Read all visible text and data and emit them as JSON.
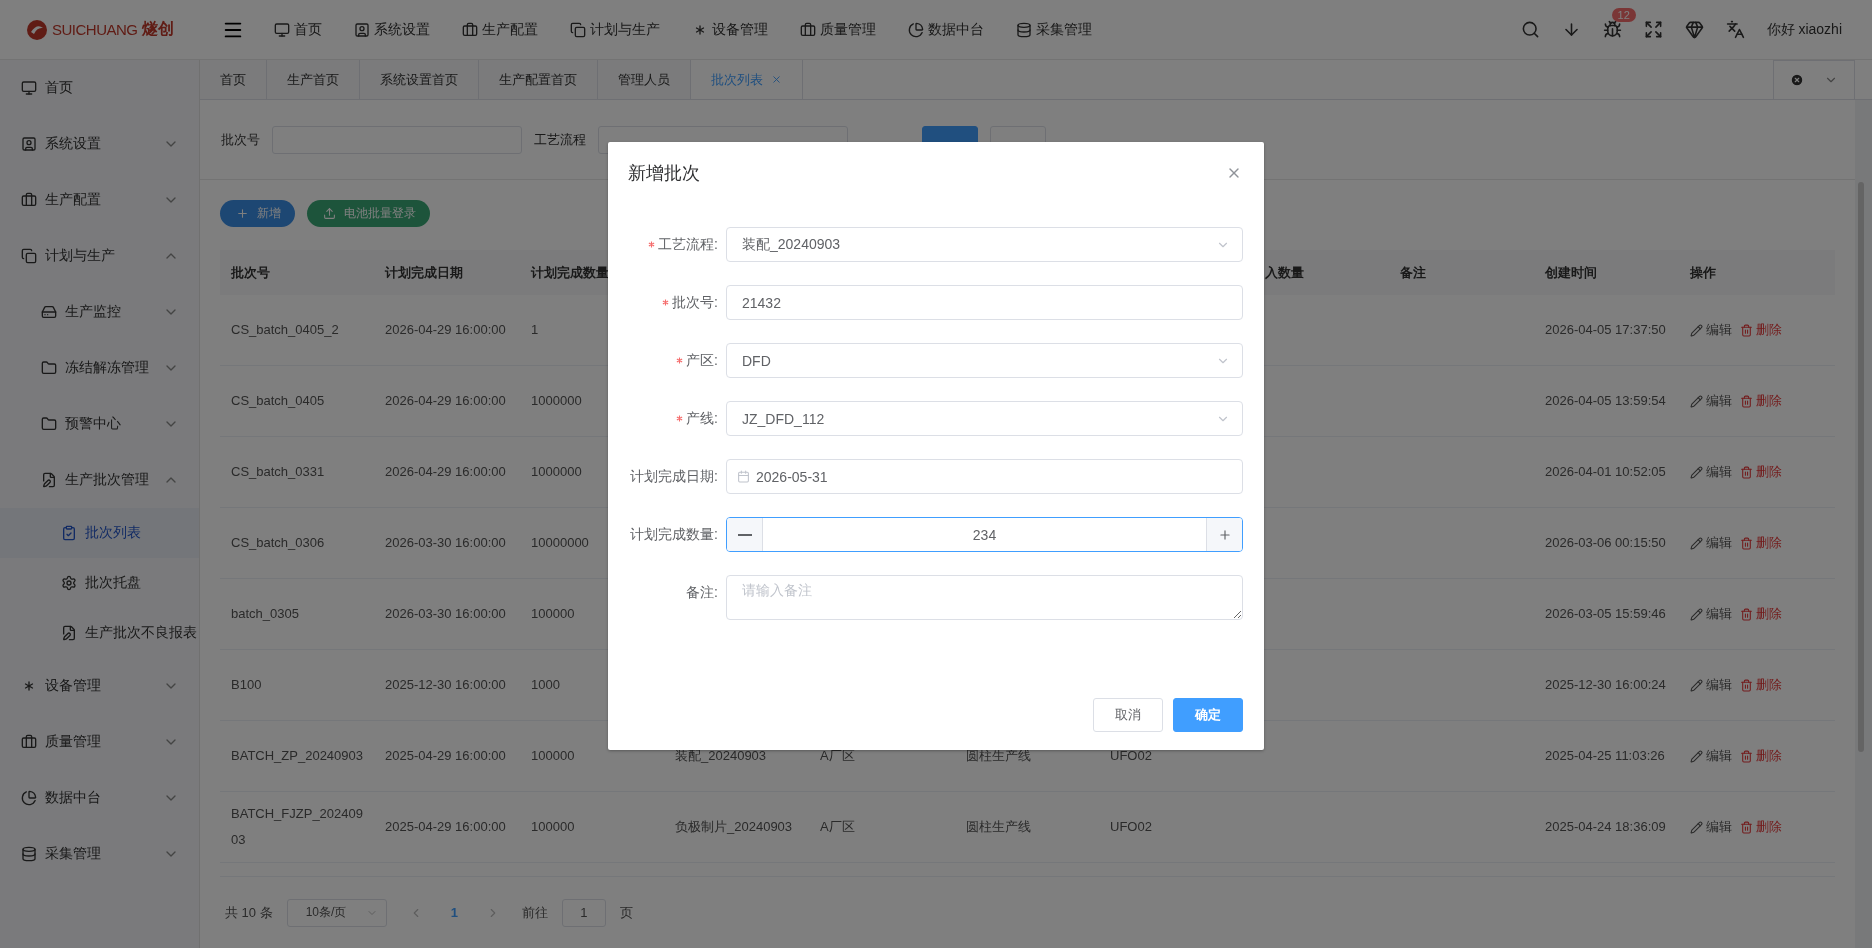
{
  "header": {
    "logo": {
      "latin": "SUICHUANG",
      "chinese": "燧创"
    },
    "nav": [
      {
        "label": "首页"
      },
      {
        "label": "系统设置"
      },
      {
        "label": "生产配置"
      },
      {
        "label": "计划与生产"
      },
      {
        "label": "设备管理"
      },
      {
        "label": "质量管理"
      },
      {
        "label": "数据中台"
      },
      {
        "label": "采集管理"
      }
    ],
    "notification_badge": "12",
    "greeting": "你好 xiaozhi"
  },
  "sidebar": {
    "items": [
      {
        "label": "首页",
        "selected": false
      },
      {
        "label": "系统设置",
        "selected": false,
        "expanded": false
      },
      {
        "label": "生产配置",
        "selected": false,
        "expanded": false
      },
      {
        "label": "计划与生产",
        "selected": false,
        "expanded": true,
        "children": [
          {
            "label": "生产监控",
            "selected": false,
            "expanded": false
          },
          {
            "label": "冻结解冻管理",
            "selected": false,
            "expanded": false
          },
          {
            "label": "预警中心",
            "selected": false,
            "expanded": false
          },
          {
            "label": "生产批次管理",
            "selected": false,
            "expanded": true,
            "children": [
              {
                "label": "批次列表",
                "selected": true
              },
              {
                "label": "批次托盘",
                "selected": false
              },
              {
                "label": "生产批次不良报表",
                "selected": false
              }
            ]
          }
        ]
      },
      {
        "label": "设备管理",
        "selected": false,
        "expanded": false
      },
      {
        "label": "质量管理",
        "selected": false,
        "expanded": false
      },
      {
        "label": "数据中台",
        "selected": false,
        "expanded": false
      },
      {
        "label": "采集管理",
        "selected": false,
        "expanded": false
      }
    ]
  },
  "tabs": [
    {
      "label": "首页",
      "selected": false
    },
    {
      "label": "生产首页",
      "selected": false
    },
    {
      "label": "系统设置首页",
      "selected": false
    },
    {
      "label": "生产配置首页",
      "selected": false
    },
    {
      "label": "管理人员",
      "selected": false
    },
    {
      "label": "批次列表",
      "selected": true,
      "closable": true
    }
  ],
  "filters": {
    "batch_label": "批次号",
    "process_label": "工艺流程"
  },
  "toolbar": {
    "add_button": "新增",
    "import_button": "电池批量登录"
  },
  "table": {
    "columns": [
      "批次号",
      "计划完成日期",
      "计划完成数量",
      "入数量",
      "备注",
      "创建时间",
      "操作"
    ],
    "rows": [
      {
        "batch_no": "CS_batch_0405_2",
        "planned_date": "2026-04-29 16:00:00",
        "planned_qty": "1",
        "created_at": "2026-04-05 17:37:50",
        "actions": [
          "编辑",
          "删除"
        ]
      },
      {
        "batch_no": "CS_batch_0405",
        "planned_date": "2026-04-29 16:00:00",
        "planned_qty": "1000000",
        "created_at": "2026-04-05 13:59:54",
        "actions": [
          "编辑",
          "删除"
        ]
      },
      {
        "batch_no": "CS_batch_0331",
        "planned_date": "2026-04-29 16:00:00",
        "planned_qty": "1000000",
        "created_at": "2026-04-01 10:52:05",
        "actions": [
          "编辑",
          "删除"
        ]
      },
      {
        "batch_no": "CS_batch_0306",
        "planned_date": "2026-03-30 16:00:00",
        "planned_qty": "10000000",
        "created_at": "2026-03-06 00:15:50",
        "actions": [
          "编辑",
          "删除"
        ]
      },
      {
        "batch_no": "batch_0305",
        "planned_date": "2026-03-30 16:00:00",
        "planned_qty": "100000",
        "created_at": "2026-03-05 15:59:46",
        "actions": [
          "编辑",
          "删除"
        ]
      },
      {
        "batch_no": "B100",
        "planned_date": "2025-12-30 16:00:00",
        "planned_qty": "1000",
        "created_at": "2025-12-30 16:00:24",
        "actions": [
          "编辑",
          "删除"
        ]
      },
      {
        "batch_no": "BATCH_ZP_20240903",
        "planned_date": "2025-04-29 16:00:00",
        "planned_qty": "100000",
        "column_4": "装配_20240903",
        "column_5": "A厂区",
        "column_6": "圆柱生产线",
        "column_7": "UFO02",
        "created_at": "2025-04-25 11:03:26",
        "actions": [
          "编辑",
          "删除"
        ]
      },
      {
        "batch_no": "BATCH_FJZP_20240903",
        "planned_date": "2025-04-29 16:00:00",
        "planned_qty": "100000",
        "column_4": "负极制片_20240903",
        "column_5": "A厂区",
        "column_6": "圆柱生产线",
        "column_7": "UFO02",
        "created_at": "2025-04-24 18:36:09",
        "actions": [
          "编辑",
          "删除"
        ]
      }
    ]
  },
  "pagination": {
    "total": "共 10 条",
    "page_size": "10条/页",
    "pages": [
      {
        "label": "1",
        "selected": true
      }
    ],
    "goto_label": "前往",
    "goto_value": "1",
    "page_suffix": "页"
  },
  "modal": {
    "title": "新增批次",
    "fields": [
      {
        "kind": "select",
        "label": "工艺流程:",
        "required": true,
        "value": "装配_20240903"
      },
      {
        "kind": "text",
        "label": "批次号:",
        "required": true,
        "value": "21432"
      },
      {
        "kind": "select",
        "label": "产区:",
        "required": true,
        "value": "DFD"
      },
      {
        "kind": "select",
        "label": "产线:",
        "required": true,
        "value": "JZ_DFD_112"
      },
      {
        "kind": "date",
        "label": "计划完成日期:",
        "required": false,
        "value": "2026-05-31"
      },
      {
        "kind": "number",
        "label": "计划完成数量:",
        "required": false,
        "value": "234",
        "focused": true
      },
      {
        "kind": "textarea",
        "label": "备注:",
        "required": false,
        "placeholder": "请输入备注"
      }
    ],
    "cancel_button": "取消",
    "confirm_button": "确定"
  }
}
